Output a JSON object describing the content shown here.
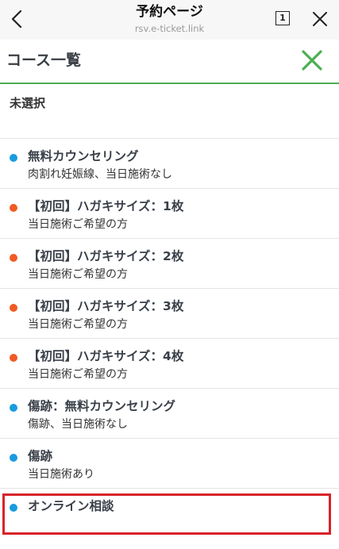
{
  "browser": {
    "title": "予約ページ",
    "url": "rsv.e-ticket.link",
    "tab_count": "1",
    "back_icon": "chevron-left-icon",
    "close_icon": "close-icon"
  },
  "header": {
    "title": "コース一覧",
    "close_icon": "close-icon",
    "accent": "#4caf50"
  },
  "unselected_label": "未選択",
  "colors": {
    "blue": "#1a9be0",
    "orange": "#f05a24",
    "highlight": "#d8232a"
  },
  "courses": [
    {
      "name": "無料カウンセリング",
      "sub": "肉割れ妊娠線、当日施術なし",
      "dot": "blue"
    },
    {
      "name": "【初回】ハガキサイズ：1枚",
      "sub": "当日施術ご希望の方",
      "dot": "orange"
    },
    {
      "name": "【初回】ハガキサイズ：2枚",
      "sub": "当日施術ご希望の方",
      "dot": "orange"
    },
    {
      "name": "【初回】ハガキサイズ：3枚",
      "sub": "当日施術ご希望の方",
      "dot": "orange"
    },
    {
      "name": "【初回】ハガキサイズ：4枚",
      "sub": "当日施術ご希望の方",
      "dot": "orange"
    },
    {
      "name": "傷跡：無料カウンセリング",
      "sub": "傷跡、当日施術なし",
      "dot": "blue"
    },
    {
      "name": "傷跡",
      "sub": "当日施術あり",
      "dot": "blue"
    },
    {
      "name": "オンライン相談",
      "sub": "",
      "dot": "blue"
    }
  ]
}
